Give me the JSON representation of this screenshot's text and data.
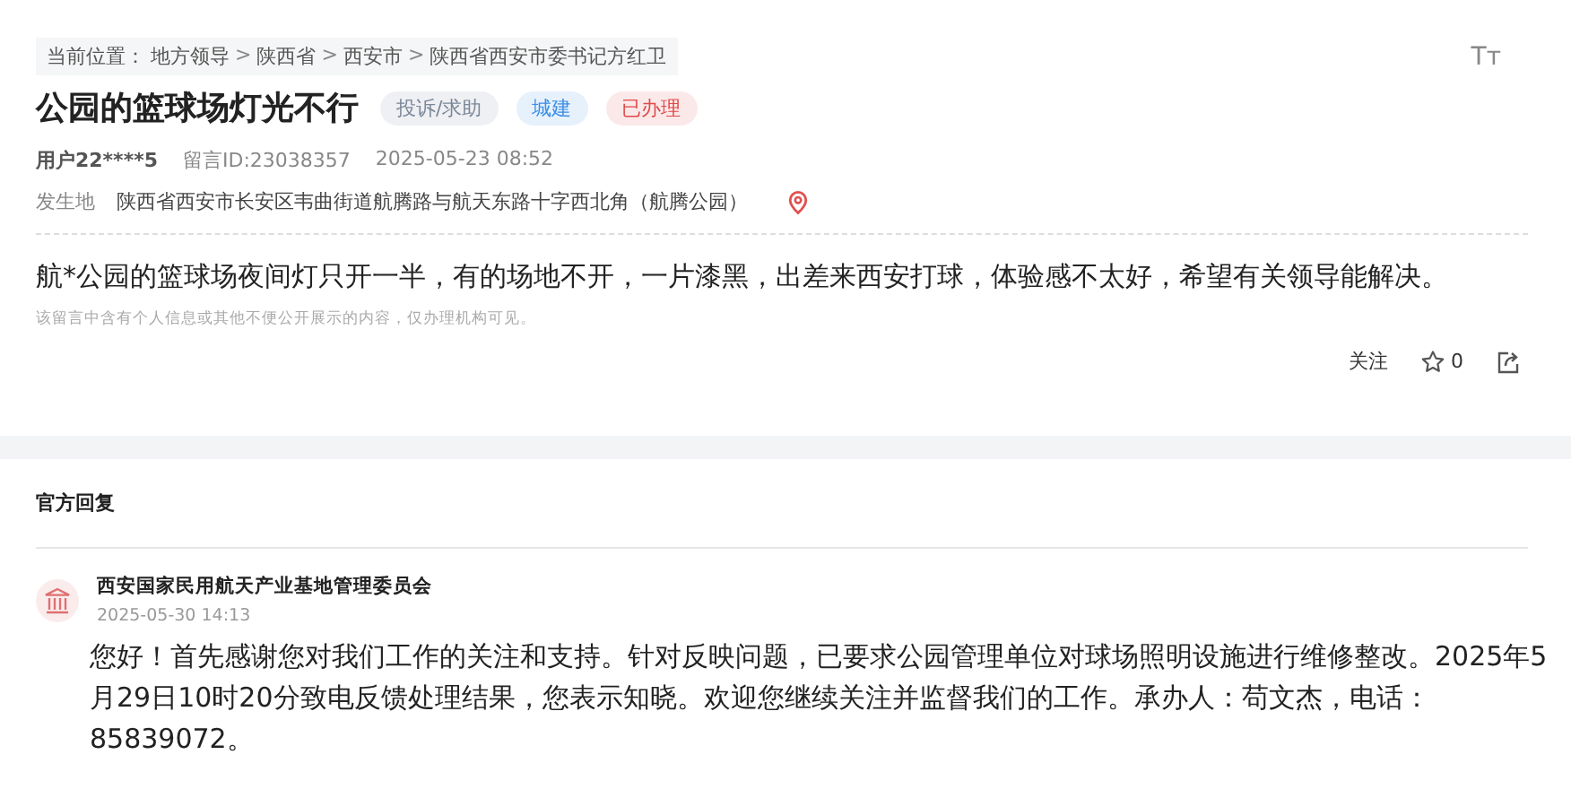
{
  "breadcrumb": {
    "label": "当前位置：",
    "items": [
      "地方领导",
      "陕西省",
      "西安市",
      "陕西省西安市委书记方红卫"
    ],
    "separator": ">"
  },
  "font_size_button": "Tт",
  "title": "公园的篮球场灯光不行",
  "tags": [
    {
      "label": "投诉/求助",
      "color": "#7a8799"
    },
    {
      "label": "城建",
      "color": "#3a8ee6"
    },
    {
      "label": "已办理",
      "color": "#e04a4a"
    }
  ],
  "meta": {
    "user": "用户22****5",
    "message_id": "留言ID:23038357",
    "time": "2025-05-23 08:52"
  },
  "location": {
    "label": "发生地",
    "address": "陕西省西安市长安区韦曲街道航腾路与航天东路十字西北角（航腾公园）"
  },
  "content": "航*公园的篮球场夜间灯只开一半，有的场地不开，一片漆黑，出差来西安打球，体验感不太好，希望有关领导能解决。",
  "privacy_note": "该留言中含有个人信息或其他不便公开展示的内容，仅办理机构可见。",
  "actions": {
    "follow": "关注",
    "likes": "0"
  },
  "reply_section": {
    "heading": "官方回复",
    "organization": "西安国家民用航天产业基地管理委员会",
    "time": "2025-05-30 14:13",
    "text": "您好！首先感谢您对我们工作的关注和支持。针对反映问题，已要求公园管理单位对球场照明设施进行维修整改。2025年5月29日10时20分致电反馈处理结果，您表示知晓。欢迎您继续关注并监督我们的工作。承办人：苟文杰，电话：85839072。"
  }
}
